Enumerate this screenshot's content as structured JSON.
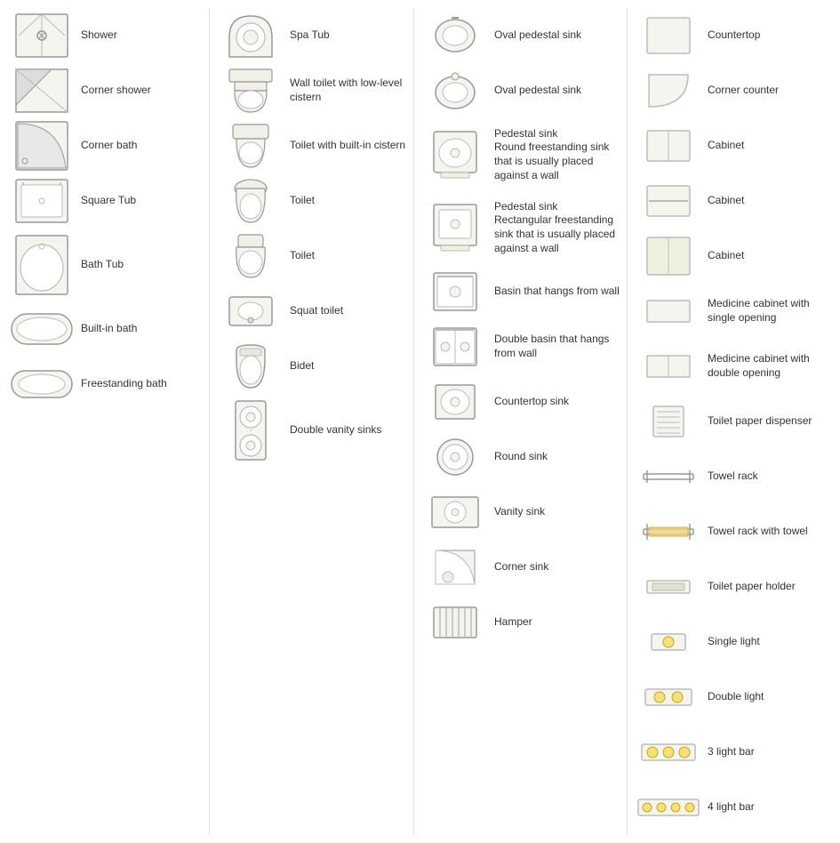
{
  "columns": [
    {
      "id": "col1",
      "items": [
        {
          "id": "shower",
          "label": "Shower",
          "icon": "shower"
        },
        {
          "id": "corner-shower",
          "label": "Corner shower",
          "icon": "corner-shower"
        },
        {
          "id": "corner-bath",
          "label": "Corner bath",
          "icon": "corner-bath"
        },
        {
          "id": "square-tub",
          "label": "Square Tub",
          "icon": "square-tub"
        },
        {
          "id": "bath-tub",
          "label": "Bath Tub",
          "icon": "bath-tub",
          "tall": true
        },
        {
          "id": "built-in-bath",
          "label": "Built-in bath",
          "icon": "built-in-bath"
        },
        {
          "id": "freestanding-bath",
          "label": "Freestanding bath",
          "icon": "freestanding-bath"
        }
      ]
    },
    {
      "id": "col2",
      "items": [
        {
          "id": "spa-tub",
          "label": "Spa Tub",
          "icon": "spa-tub"
        },
        {
          "id": "wall-toilet",
          "label": "Wall toilet with low-level cistern",
          "icon": "wall-toilet"
        },
        {
          "id": "toilet-builtin",
          "label": "Toilet with built-in cistern",
          "icon": "toilet-builtin"
        },
        {
          "id": "toilet1",
          "label": "Toilet",
          "icon": "toilet1"
        },
        {
          "id": "toilet2",
          "label": "Toilet",
          "icon": "toilet2"
        },
        {
          "id": "squat-toilet",
          "label": "Squat toilet",
          "icon": "squat-toilet"
        },
        {
          "id": "bidet",
          "label": "Bidet",
          "icon": "bidet"
        },
        {
          "id": "double-vanity",
          "label": "Double vanity sinks",
          "icon": "double-vanity",
          "tall": true
        }
      ]
    },
    {
      "id": "col3",
      "items": [
        {
          "id": "oval-pedestal1",
          "label": "Oval pedestal sink",
          "icon": "oval-pedestal1"
        },
        {
          "id": "oval-pedestal2",
          "label": "Oval pedestal sink",
          "icon": "oval-pedestal2"
        },
        {
          "id": "pedestal-sink1",
          "label": "Pedestal sink",
          "sub": "Round freestanding sink that is usually placed against a wall",
          "icon": "pedestal-sink1"
        },
        {
          "id": "pedestal-sink2",
          "label": "Pedestal sink",
          "sub": "Rectangular freestanding sink that is usually placed against a wall",
          "icon": "pedestal-sink2"
        },
        {
          "id": "basin-wall",
          "label": "Basin that hangs from wall",
          "icon": "basin-wall"
        },
        {
          "id": "double-basin",
          "label": "Double basin that hangs from wall",
          "icon": "double-basin"
        },
        {
          "id": "countertop-sink",
          "label": "Countertop sink",
          "icon": "countertop-sink"
        },
        {
          "id": "round-sink",
          "label": "Round sink",
          "icon": "round-sink"
        },
        {
          "id": "vanity-sink",
          "label": "Vanity sink",
          "icon": "vanity-sink"
        },
        {
          "id": "corner-sink",
          "label": "Corner sink",
          "icon": "corner-sink"
        },
        {
          "id": "hamper",
          "label": "Hamper",
          "icon": "hamper"
        }
      ]
    },
    {
      "id": "col4",
      "items": [
        {
          "id": "countertop",
          "label": "Countertop",
          "icon": "countertop"
        },
        {
          "id": "corner-counter",
          "label": "Corner counter",
          "icon": "corner-counter"
        },
        {
          "id": "cabinet1",
          "label": "Cabinet",
          "icon": "cabinet1"
        },
        {
          "id": "cabinet2",
          "label": "Cabinet",
          "icon": "cabinet2"
        },
        {
          "id": "cabinet3",
          "label": "Cabinet",
          "icon": "cabinet3"
        },
        {
          "id": "med-cabinet-single",
          "label": "Medicine cabinet with single opening",
          "icon": "med-cabinet-single"
        },
        {
          "id": "med-cabinet-double",
          "label": "Medicine cabinet with double opening",
          "icon": "med-cabinet-double"
        },
        {
          "id": "tp-dispenser",
          "label": "Toilet paper dispenser",
          "icon": "tp-dispenser"
        },
        {
          "id": "towel-rack",
          "label": "Towel rack",
          "icon": "towel-rack"
        },
        {
          "id": "towel-rack-towel",
          "label": "Towel rack with towel",
          "icon": "towel-rack-towel"
        },
        {
          "id": "tp-holder",
          "label": "Toilet paper holder",
          "icon": "tp-holder"
        },
        {
          "id": "single-light",
          "label": "Single light",
          "icon": "single-light"
        },
        {
          "id": "double-light",
          "label": "Double light",
          "icon": "double-light"
        },
        {
          "id": "3-light-bar",
          "label": "3 light bar",
          "icon": "3-light-bar"
        },
        {
          "id": "4-light-bar",
          "label": "4 light bar",
          "icon": "4-light-bar"
        }
      ]
    }
  ]
}
